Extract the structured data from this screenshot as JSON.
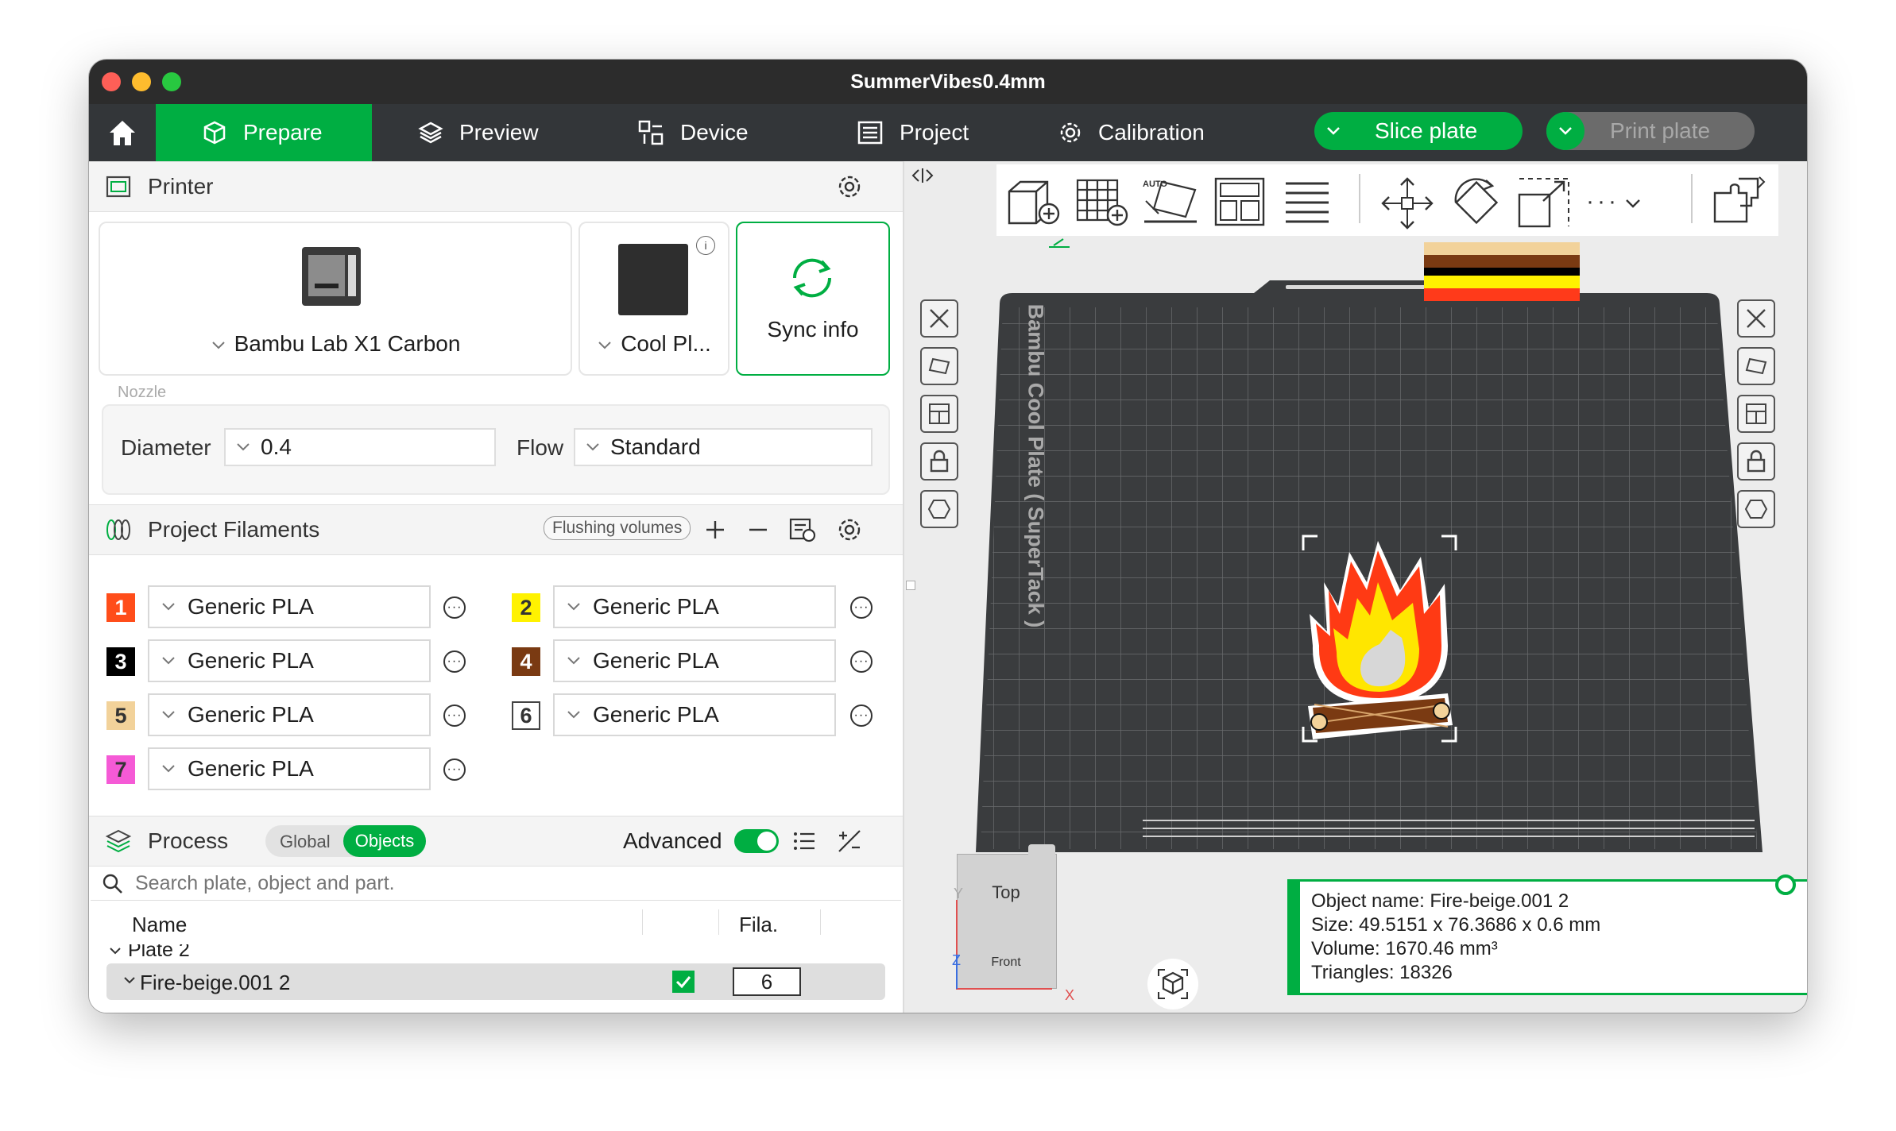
{
  "window": {
    "title": "SummerVibes0.4mm"
  },
  "tabs": [
    {
      "label": "Prepare",
      "icon": "cube-icon",
      "active": true
    },
    {
      "label": "Preview",
      "icon": "layers-icon"
    },
    {
      "label": "Device",
      "icon": "device-icon"
    },
    {
      "label": "Project",
      "icon": "project-icon"
    },
    {
      "label": "Calibration",
      "icon": "calibration-icon"
    }
  ],
  "actions": {
    "slice_label": "Slice plate",
    "print_label": "Print plate"
  },
  "printer": {
    "section_label": "Printer",
    "name": "Bambu Lab X1 Carbon",
    "plate": "Cool Pl...",
    "sync_label": "Sync info",
    "nozzle_label": "Nozzle",
    "diameter_label": "Diameter",
    "diameter_value": "0.4",
    "flow_label": "Flow",
    "flow_value": "Standard"
  },
  "filaments": {
    "section_label": "Project Filaments",
    "flushing_label": "Flushing volumes",
    "items": [
      {
        "num": "1",
        "color": "#ff4d1a",
        "name": "Generic PLA"
      },
      {
        "num": "2",
        "color": "#fff200",
        "name": "Generic PLA"
      },
      {
        "num": "3",
        "color": "#000000",
        "name": "Generic PLA"
      },
      {
        "num": "4",
        "color": "#7a3a12",
        "name": "Generic PLA"
      },
      {
        "num": "5",
        "color": "#f2d29a",
        "name": "Generic PLA"
      },
      {
        "num": "6",
        "color": "#ffffff",
        "name": "Generic PLA"
      },
      {
        "num": "7",
        "color": "#f55ad6",
        "name": "Generic PLA"
      }
    ]
  },
  "process": {
    "section_label": "Process",
    "toggle_global": "Global",
    "toggle_objects": "Objects",
    "advanced_label": "Advanced",
    "search_placeholder": "Search plate, object and part.",
    "col_name": "Name",
    "col_fila": "Fila.",
    "plate_row": "Plate 2",
    "object_row": "Fire-beige.001 2",
    "object_fila": "6"
  },
  "plate": {
    "label": "Bambu Cool Plate ( SuperTack )"
  },
  "viewcube": {
    "top": "Top",
    "front": "Front",
    "x": "X",
    "y": "Y",
    "z": "Z"
  },
  "object_info": {
    "name_line": "Object name: Fire-beige.001 2",
    "size_line": "Size: 49.5151 x 76.3686 x 0.6 mm",
    "volume_line": "Volume: 1670.46 mm³",
    "triangles_line": "Triangles: 18326"
  },
  "colors": {
    "accent": "#00ae42",
    "bed": "#3a3c3e",
    "tabbar": "#333639"
  }
}
